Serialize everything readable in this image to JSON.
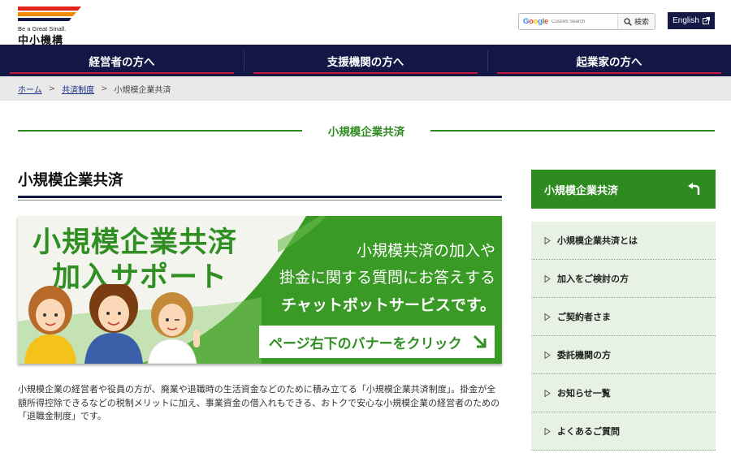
{
  "header": {
    "logo_tagline": "Be a Great Small.",
    "logo_name": "中小機構",
    "search_brand": "Google",
    "search_placeholder": "Custom Search",
    "search_button": "検索",
    "english_label": "English"
  },
  "nav": {
    "items": [
      {
        "label": "経営者の方へ"
      },
      {
        "label": "支援機関の方へ"
      },
      {
        "label": "起業家の方へ"
      }
    ]
  },
  "breadcrumb": {
    "home": "ホーム",
    "sep": ">",
    "parent": "共済制度",
    "current": "小規模企業共済"
  },
  "page_title": "小規模企業共済",
  "main": {
    "heading": "小規模企業共済",
    "banner": {
      "title_line1": "小規模企業共済",
      "title_line2": "加入サポート",
      "line1": "小規模共済の加入や",
      "line2": "掛金に関する質問にお答えする",
      "line3": "チャットボットサービスです。",
      "button": "ページ右下のバナーをクリック"
    },
    "description": "小規模企業の経営者や役員の方が、廃業や退職時の生活資金などのために積み立てる「小規模企業共済制度」。掛金が全額所得控除できるなどの税制メリットに加え、事業資金の借入れもできる、おトクで安心な小規模企業の経営者のための「退職金制度」です。"
  },
  "sidebar": {
    "header": "小規模企業共済",
    "items": [
      {
        "label": "小規模企業共済とは"
      },
      {
        "label": "加入をご検討の方"
      },
      {
        "label": "ご契約者さま"
      },
      {
        "label": "委託機関の方"
      },
      {
        "label": "お知らせ一覧"
      },
      {
        "label": "よくあるご質問"
      }
    ]
  },
  "colors": {
    "navy": "#121745",
    "green": "#2e8b1f",
    "red": "#c8163a",
    "light_green": "#e7f1e4"
  }
}
